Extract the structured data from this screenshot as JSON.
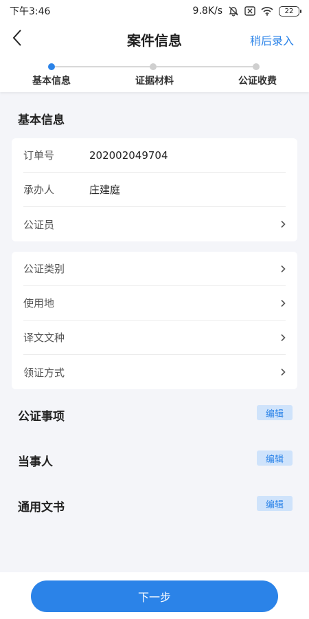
{
  "status_bar": {
    "time": "下午3:46",
    "speed": "9.8K/s",
    "battery": "22",
    "icons": [
      "mute-bell-icon",
      "close-box-icon",
      "wifi-icon",
      "battery-icon"
    ]
  },
  "nav": {
    "title": "案件信息",
    "later_label": "稍后录入",
    "back_icon": "chevron-left-icon"
  },
  "steps": [
    {
      "label": "基本信息",
      "active": true
    },
    {
      "label": "证据材料",
      "active": false
    },
    {
      "label": "公证收费",
      "active": false
    }
  ],
  "basic_section": {
    "title": "基本信息",
    "card1": [
      {
        "label": "订单号",
        "value": "202002049704"
      },
      {
        "label": "承办人",
        "value": "庄建庭"
      },
      {
        "label": "公证员",
        "value": ""
      }
    ],
    "card2": [
      {
        "label": "公证类别"
      },
      {
        "label": "使用地"
      },
      {
        "label": "译文文种"
      },
      {
        "label": "领证方式"
      }
    ]
  },
  "sections": [
    {
      "title": "公证事项",
      "edit_label": "编辑"
    },
    {
      "title": "当事人",
      "edit_label": "编辑"
    },
    {
      "title": "通用文书",
      "edit_label": "编辑"
    }
  ],
  "footer": {
    "next_label": "下一步"
  },
  "colors": {
    "accent": "#2b83e8",
    "background": "#f4f5f9",
    "edit_bg": "#cfe3fb"
  }
}
